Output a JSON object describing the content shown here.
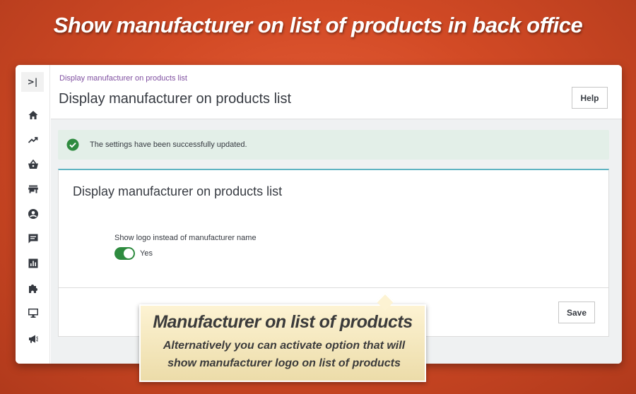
{
  "banner": {
    "title": "Show manufacturer on list of products in back office"
  },
  "sidebar": {
    "toggle_label": ">|",
    "items": [
      {
        "icon": "home-icon"
      },
      {
        "icon": "trending-icon"
      },
      {
        "icon": "basket-icon"
      },
      {
        "icon": "store-icon"
      },
      {
        "icon": "customer-icon"
      },
      {
        "icon": "chat-icon"
      },
      {
        "icon": "stats-icon"
      },
      {
        "icon": "puzzle-icon"
      },
      {
        "icon": "monitor-icon"
      },
      {
        "icon": "megaphone-icon"
      }
    ]
  },
  "header": {
    "breadcrumb": "Display manufacturer on products list",
    "title": "Display manufacturer on products list",
    "help_label": "Help"
  },
  "alert": {
    "message": "The settings have been successfully updated."
  },
  "card": {
    "title": "Display manufacturer on products list",
    "field_label": "Show logo instead of manufacturer name",
    "switch_state": "Yes",
    "save_label": "Save"
  },
  "callout": {
    "title": "Manufacturer on list of products",
    "description": "Alternatively you can activate option that will show manufacturer logo on list of products"
  },
  "colors": {
    "background": "#d24a25",
    "accent_purple": "#7f4fa0",
    "success_green": "#2e8b3f",
    "alert_bg": "#e3efe8",
    "card_top_border": "#5fb3c2",
    "callout_bg": "#fdf3d3"
  }
}
